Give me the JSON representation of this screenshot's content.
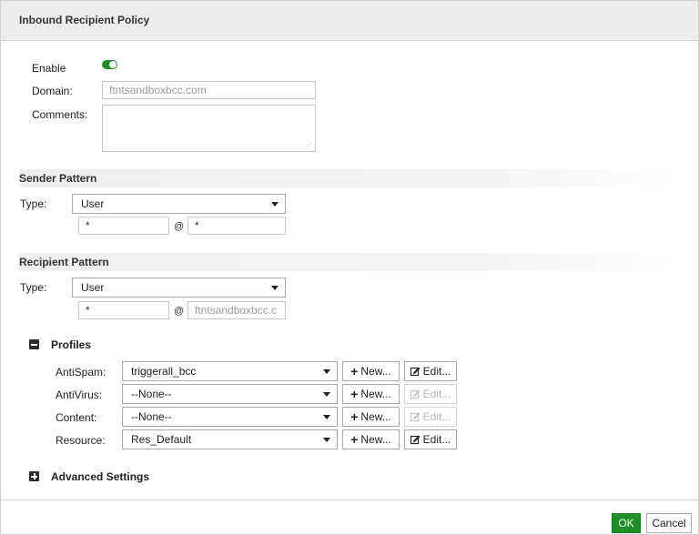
{
  "dialog": {
    "title": "Inbound Recipient Policy"
  },
  "general": {
    "enable_label": "Enable",
    "enable_on": true,
    "domain_label": "Domain:",
    "domain_placeholder": "ftntsandboxbcc.com",
    "comments_label": "Comments:"
  },
  "sender_pattern": {
    "title": "Sender Pattern",
    "type_label": "Type:",
    "type_value": "User",
    "local_value": "*",
    "at": "@",
    "domain_value": "*"
  },
  "recipient_pattern": {
    "title": "Recipient Pattern",
    "type_label": "Type:",
    "type_value": "User",
    "local_value": "*",
    "at": "@",
    "domain_value": "ftntsandboxbcc.c"
  },
  "profiles": {
    "title": "Profiles",
    "expanded": true,
    "rows": [
      {
        "label": "AntiSpam:",
        "value": "triggerall_bcc",
        "new_label": "New...",
        "edit_label": "Edit...",
        "edit_enabled": true
      },
      {
        "label": "AntiVirus:",
        "value": "--None--",
        "new_label": "New...",
        "edit_label": "Edit...",
        "edit_enabled": false
      },
      {
        "label": "Content:",
        "value": "--None--",
        "new_label": "New...",
        "edit_label": "Edit...",
        "edit_enabled": false
      },
      {
        "label": "Resource:",
        "value": "Res_Default",
        "new_label": "New...",
        "edit_label": "Edit...",
        "edit_enabled": true
      }
    ]
  },
  "advanced": {
    "title": "Advanced Settings",
    "expanded": false
  },
  "footer": {
    "ok_label": "OK",
    "cancel_label": "Cancel"
  },
  "colors": {
    "accent_green": "#1f8f28",
    "disabled_text": "#b7b7b7"
  }
}
